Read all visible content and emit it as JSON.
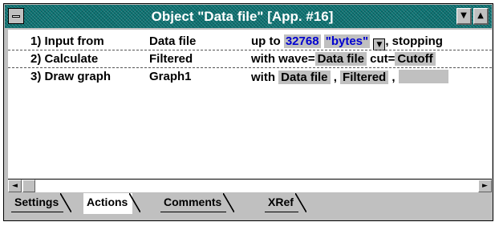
{
  "window": {
    "title": "Object \"Data file\" [App. #16]",
    "sysmenu_icon": "sysmenu-icon",
    "down_arrow": "▼",
    "up_arrow": "▲"
  },
  "rows": [
    {
      "num": "1)",
      "action": "Input from",
      "target": "Data file",
      "p1": "up to",
      "amount": "32768",
      "unit": "\"bytes\"",
      "dd": "▼",
      "tail": ", stopping"
    },
    {
      "num": "2)",
      "action": "Calculate",
      "target": "Filtered",
      "p1": "with wave=",
      "wave": "Data file",
      "p2": "cut=",
      "cut": "Cutoff"
    },
    {
      "num": "3)",
      "action": "Draw graph",
      "target": "Graph1",
      "p1": "with",
      "s1": "Data file",
      "sep1": ",",
      "s2": "Filtered",
      "sep2": ","
    }
  ],
  "scroll": {
    "left": "◄",
    "right": "►"
  },
  "tabs": [
    "Settings",
    "Actions",
    "Comments",
    "XRef"
  ],
  "colors": {
    "titlebar": "#0c7272",
    "link_blue": "#0000d0",
    "field_gray": "#c0c0c0"
  }
}
